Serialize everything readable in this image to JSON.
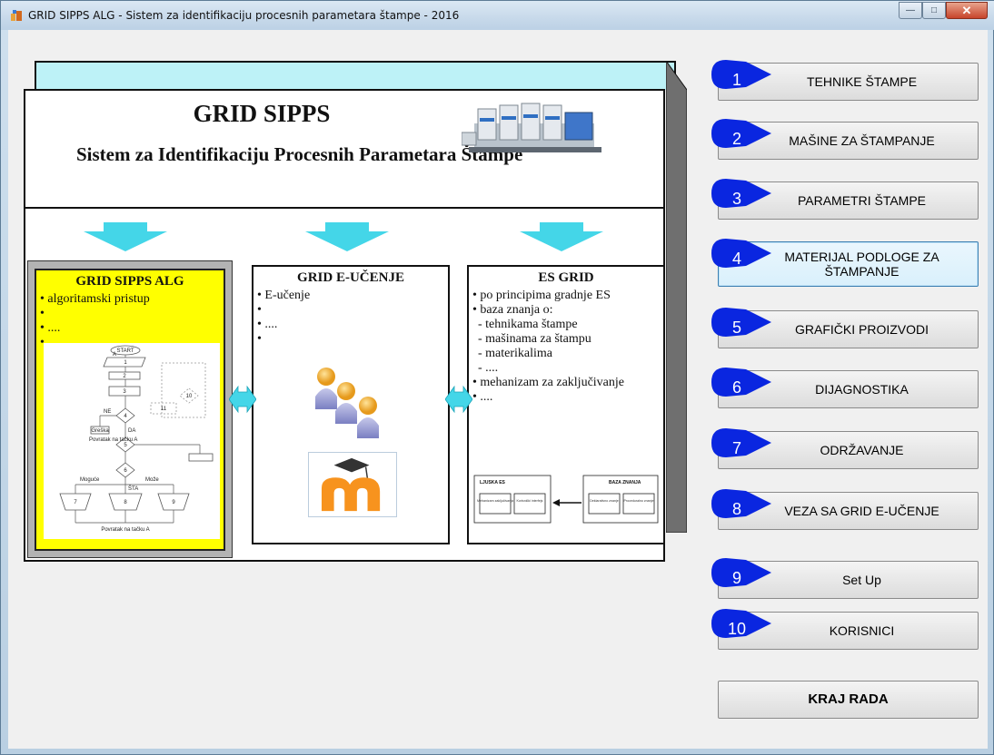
{
  "window": {
    "title": "GRID SIPPS ALG - Sistem za identifikaciju procesnih parametara štampe - 2016"
  },
  "diagram": {
    "title": "GRID SIPPS",
    "subtitle": "Sistem za Identifikaciju Procesnih Parametara Štampe",
    "panels": {
      "alg": {
        "title": "GRID SIPPS ALG",
        "items": [
          "algoritamski pristup",
          "",
          "....",
          ""
        ]
      },
      "eucenje": {
        "title": "GRID E-UČENJE",
        "items": [
          "E-učenje",
          "",
          "....",
          ""
        ]
      },
      "es": {
        "title": "ES GRID",
        "items": [
          {
            "text": "po principima gradnje ES",
            "bullet": true
          },
          {
            "text": "baza znanja o:",
            "bullet": true
          },
          {
            "text": "- tehnikama štampe",
            "bullet": false
          },
          {
            "text": "- mašinama za štampu",
            "bullet": false
          },
          {
            "text": "- materikalima",
            "bullet": false
          },
          {
            "text": "- ....",
            "bullet": false
          },
          {
            "text": "mehanizam za zaključivanje",
            "bullet": true
          },
          {
            "text": "....",
            "bullet": true
          }
        ],
        "diagram_labels": {
          "shell": "LJUSKA ES",
          "knowledge": "BAZA ZNANJA",
          "cell1": "Mehanizam zaključivanja",
          "cell2": "Korisnički interfejs",
          "cell3": "Deklarativno znanje",
          "cell4": "Proceduralno znanje"
        }
      }
    },
    "flowchart_labels": {
      "start": "START",
      "a": "A",
      "n1": "1",
      "n2": "2",
      "n3": "3",
      "n4": "4",
      "n5": "5",
      "n6": "6",
      "n7": "7",
      "n8": "8",
      "n9": "9",
      "n10": "10",
      "n11": "11",
      "ne": "NE",
      "da": "DA",
      "greska": "Greška",
      "povratak_a": "Povratak na tačku A",
      "moguce": "Moguće",
      "moze": "Može",
      "sta": "ŠTA",
      "povratak_final": "Povratak na tačku A"
    }
  },
  "nav": {
    "buttons": [
      {
        "num": "1",
        "label": "TEHNIKE ŠTAMPE"
      },
      {
        "num": "2",
        "label": "MAŠINE ZA ŠTAMPANJE"
      },
      {
        "num": "3",
        "label": "PARAMETRI ŠTAMPE"
      },
      {
        "num": "4",
        "label": "MATERIJAL PODLOGE ZA ŠTAMPANJE"
      },
      {
        "num": "5",
        "label": "GRAFIČKI PROIZVODI"
      },
      {
        "num": "6",
        "label": "DIJAGNOSTIKA"
      },
      {
        "num": "7",
        "label": "ODRŽAVANJE"
      },
      {
        "num": "8",
        "label": "VEZA SA GRID E-UČENJE"
      },
      {
        "num": "9",
        "label": "Set Up"
      },
      {
        "num": "10",
        "label": "KORISNICI"
      }
    ],
    "exit_label": "KRAJ RADA"
  },
  "colors": {
    "badge": "#0a26e0",
    "arrow": "#44d6e8",
    "highlight": "#ffff00"
  }
}
